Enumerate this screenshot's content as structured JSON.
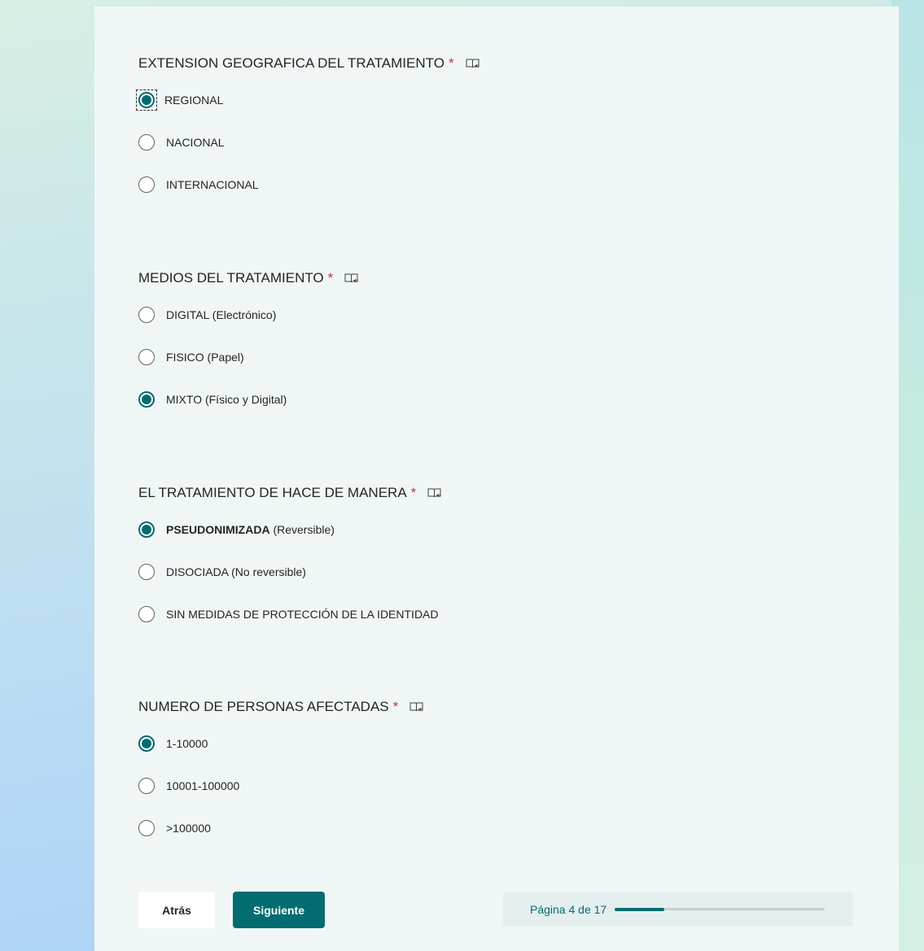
{
  "questions": [
    {
      "title": "EXTENSION GEOGRAFICA DEL TRATAMIENTO",
      "required_mark": "*",
      "reader_icon": "immersive-reader-icon",
      "options": [
        {
          "label": "REGIONAL",
          "selected": true
        },
        {
          "label": "NACIONAL",
          "selected": false
        },
        {
          "label": "INTERNACIONAL",
          "selected": false
        }
      ]
    },
    {
      "title": "MEDIOS DEL TRATAMIENTO",
      "required_mark": "*",
      "reader_icon": "immersive-reader-icon",
      "options": [
        {
          "label": "DIGITAL (Electrónico)",
          "selected": false
        },
        {
          "label": "FISICO (Papel)",
          "selected": false
        },
        {
          "label": "MIXTO (Físico y Digital)",
          "selected": true
        }
      ]
    },
    {
      "title": "EL TRATAMIENTO DE HACE DE MANERA",
      "required_mark": "*",
      "reader_icon": "immersive-reader-icon",
      "options": [
        {
          "label_bold": "PSEUDONIMIZADA",
          "label": "(Reversible)",
          "selected": true
        },
        {
          "label": "DISOCIADA (No reversible)",
          "selected": false
        },
        {
          "label": "SIN MEDIDAS DE PROTECCIÓN DE LA IDENTIDAD",
          "selected": false
        }
      ]
    },
    {
      "title": "NUMERO DE PERSONAS AFECTADAS",
      "required_mark": "*",
      "reader_icon": "immersive-reader-icon",
      "options": [
        {
          "label": "1-10000",
          "selected": true
        },
        {
          "label": "10001-100000",
          "selected": false
        },
        {
          "label": ">100000",
          "selected": false
        }
      ]
    }
  ],
  "footer": {
    "back_label": "Atrás",
    "next_label": "Siguiente",
    "progress_text": "Página 4 de 17",
    "progress_fraction": 0.235
  },
  "colors": {
    "accent": "#036c70",
    "required": "#c4314b",
    "card": "#f0f6f6"
  }
}
